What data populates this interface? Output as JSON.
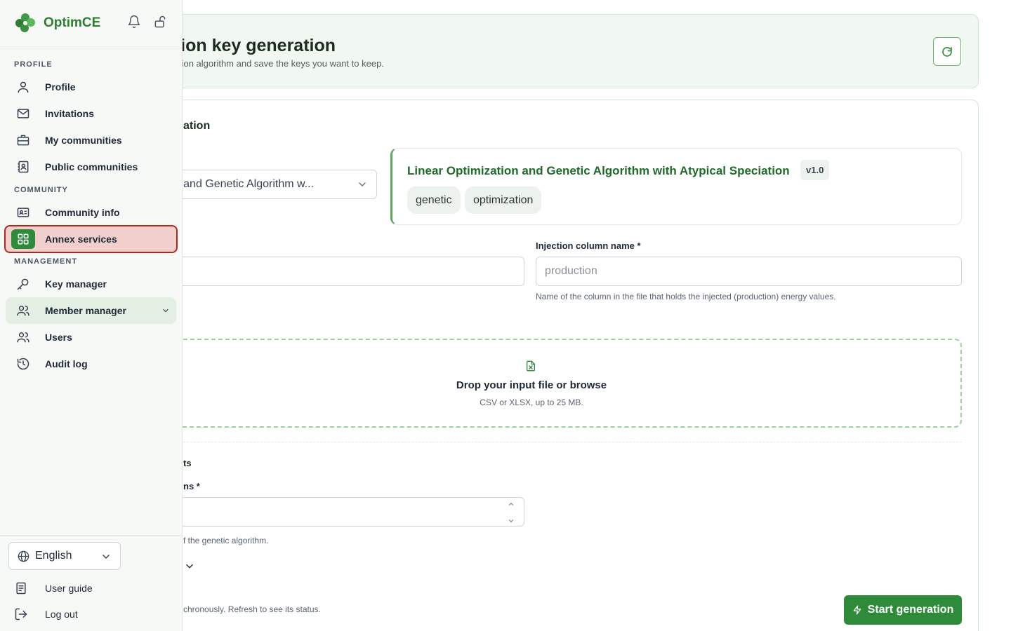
{
  "app": {
    "brand_name": "OptimCE",
    "brand_color": "#2e7d32",
    "accent_color": "#2e8b3a"
  },
  "sidebar": {
    "top_icons": [
      "bell-icon",
      "unlock-icon"
    ],
    "sections": {
      "profile": "PROFILE",
      "community": "COMMUNITY",
      "management": "MANAGEMENT"
    },
    "items": {
      "profile": "Profile",
      "invitations": "Invitations",
      "my_communities": "My communities",
      "public_communities": "Public communities",
      "community_info": "Community info",
      "annex_services": "Annex services",
      "key_manager": "Key manager",
      "member_manager": "Member manager",
      "users": "Users",
      "audit_log": "Audit log"
    },
    "active_item": "Annex services",
    "language": "English",
    "footer": {
      "user_guide": "User guide",
      "log_out": "Log out"
    }
  },
  "header": {
    "title": "cation key generation",
    "subtitle": "allocation algorithm and save the keys you want to keep."
  },
  "form": {
    "section_title": "ation",
    "algorithm_select_value": "ation and Genetic Algorithm w...",
    "algorithm": {
      "name": "Linear Optimization and Genetic Algorithm with Atypical Speciation",
      "version": "v1.0",
      "tags": [
        "genetic",
        "optimization"
      ]
    },
    "injection": {
      "label": "Injection column name *",
      "placeholder": "production",
      "help": "Name of the column in the file that holds the injected (production) energy values."
    },
    "dropzone": {
      "title": "Drop your input file or browse",
      "help": "CSV or XLSX, up to 25 MB."
    },
    "params": {
      "section_title": "ts",
      "field_label": "ns *",
      "help": "f the genetic algorithm."
    },
    "async_note": "chronously. Refresh to see its status.",
    "start_button": "Start generation"
  }
}
